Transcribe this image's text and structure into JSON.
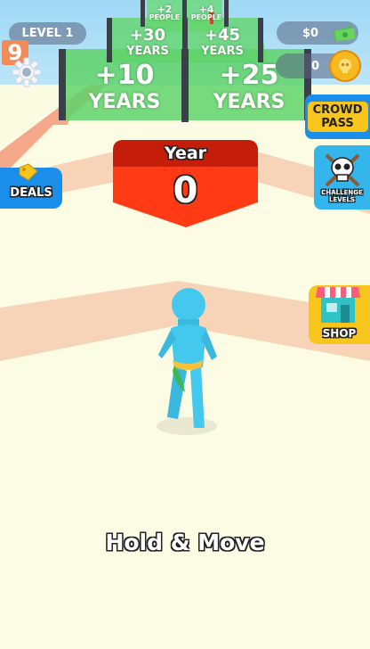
{
  "hud": {
    "level_label": "LEVEL 1",
    "fps_counter": "9",
    "money_value": "$0",
    "coin_count": "0"
  },
  "gates": [
    {
      "value": "+2",
      "unit": "PEOPLE"
    },
    {
      "value": "+4",
      "unit": "PEOPLE"
    },
    {
      "value": "+30",
      "unit": "YEARS"
    },
    {
      "value": "+45",
      "unit": "YEARS"
    },
    {
      "value": "+10",
      "unit": "YEARS"
    },
    {
      "value": "+25",
      "unit": "YEARS"
    }
  ],
  "year_panel": {
    "label": "Year",
    "value": "0"
  },
  "buttons": {
    "crowd_pass": "CROWD PASS",
    "challenge_levels": "CHALLENGE LEVELS",
    "deals": "DEALS",
    "shop": "SHOP"
  },
  "instruction": "Hold & Move",
  "colors": {
    "gate_green": "#5fd36a",
    "year_red": "#ff3a14",
    "year_dark": "#c41e0a",
    "player": "#45c8ee",
    "button_blue": "#1a8ee8",
    "button_yellow": "#f7c51c"
  },
  "icons": [
    "gear-icon",
    "cash-icon",
    "coin-icon",
    "skull-icon",
    "shop-store-icon",
    "price-tag-icon"
  ]
}
